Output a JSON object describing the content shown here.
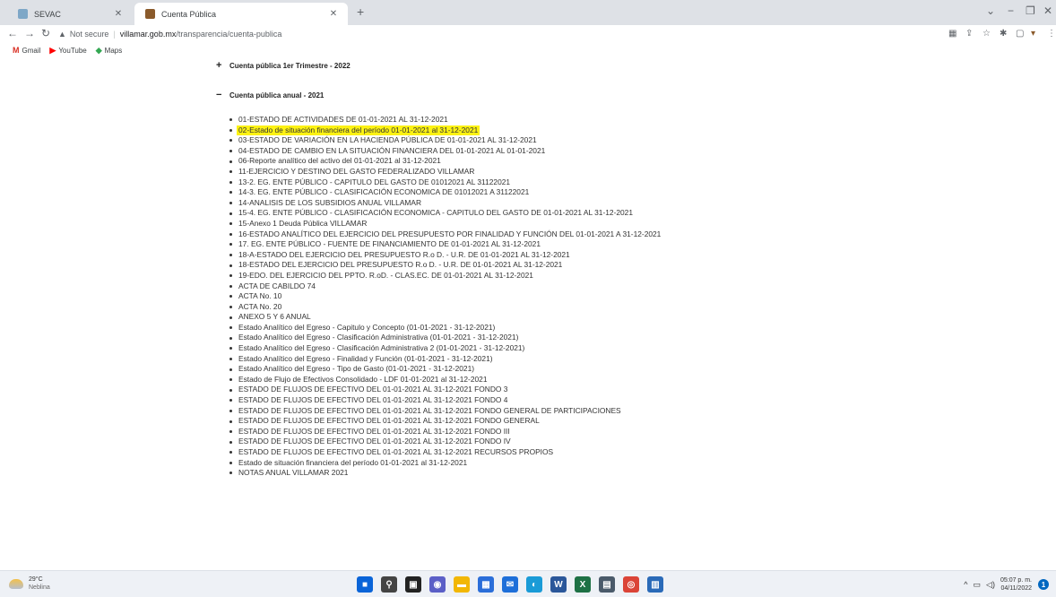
{
  "tabs": [
    {
      "title": "SEVAC",
      "favicon_color": "#7ea7c7"
    },
    {
      "title": "Cuenta Pública",
      "favicon_color": "#8a5a2b"
    }
  ],
  "toolbar": {
    "not_secure": "Not secure",
    "host": "villamar.gob.mx",
    "path": "/transparencia/cuenta-publica"
  },
  "bookmarks": [
    {
      "label": "Gmail",
      "icon": "gmail-icon",
      "color": "#d93025",
      "glyph": "M"
    },
    {
      "label": "YouTube",
      "icon": "youtube-icon",
      "color": "#ff0000",
      "glyph": "▶"
    },
    {
      "label": "Maps",
      "icon": "maps-icon",
      "color": "#34a853",
      "glyph": "◆"
    }
  ],
  "content": {
    "sections": [
      {
        "mark": "+",
        "label": "Cuenta pública 1er Trimestre - 2022"
      },
      {
        "mark": "−",
        "label": "Cuenta pública anual - 2021"
      }
    ],
    "highlight_color": "#fdf213",
    "items": [
      "01-ESTADO DE ACTIVIDADES DE 01-01-2021 AL 31-12-2021",
      "02-Estado de situación financiera del período 01-01-2021 al 31-12-2021",
      "03-ESTADO DE VARIACIÓN EN LA HACIENDA PÚBLICA DE 01-01-2021 AL 31-12-2021",
      "04-ESTADO DE CAMBIO EN LA SITUACIÓN FINANCIERA DEL 01-01-2021 AL 01-01-2021",
      "06-Reporte analítico del activo del 01-01-2021 al 31-12-2021",
      "11-EJERCICIO Y DESTINO DEL GASTO FEDERALIZADO VILLAMAR",
      "13-2. EG. ENTE PÚBLICO - CAPITULO DEL GASTO DE 01012021 AL 31122021",
      "14-3. EG. ENTE PÚBLICO - CLASIFICACIÓN ECONOMICA DE 01012021 A 31122021",
      "14-ANALISIS DE LOS SUBSIDIOS ANUAL VILLAMAR",
      "15-4. EG. ENTE PÚBLICO - CLASIFICACIÓN ECONOMICA - CAPITULO DEL GASTO DE 01-01-2021 AL 31-12-2021",
      "15-Anexo 1 Deuda Pública VILLAMAR",
      "16-ESTADO ANALÍTICO DEL EJERCICIO DEL PRESUPUESTO POR FINALIDAD Y FUNCIÓN DEL 01-01-2021 A 31-12-2021",
      "17. EG. ENTE PÚBLICO - FUENTE DE FINANCIAMIENTO DE 01-01-2021 AL 31-12-2021",
      "18-A-ESTADO DEL EJERCICIO DEL PRESUPUESTO R.o D. - U.R. DE 01-01-2021 AL 31-12-2021",
      "18-ESTADO DEL EJERCICIO DEL PRESUPUESTO R.o D. - U.R. DE 01-01-2021 AL 31-12-2021",
      "19-EDO. DEL EJERCICIO DEL PPTO. R.oD. - CLAS.EC. DE 01-01-2021 AL 31-12-2021",
      "ACTA DE CABILDO 74",
      "ACTA No. 10",
      "ACTA No. 20",
      "ANEXO 5 Y 6 ANUAL",
      "Estado Analítico del Egreso - Capitulo y Concepto (01-01-2021 - 31-12-2021)",
      "Estado Analítico del Egreso - Clasificación Administrativa (01-01-2021 - 31-12-2021)",
      "Estado Analítico del Egreso - Clasificación Administrativa 2 (01-01-2021 - 31-12-2021)",
      "Estado Analítico del Egreso - Finalidad y Función (01-01-2021 - 31-12-2021)",
      "Estado Analítico del Egreso - Tipo de Gasto (01-01-2021 - 31-12-2021)",
      "Estado de Flujo de Efectivos Consolidado - LDF 01-01-2021 al 31-12-2021",
      "ESTADO DE FLUJOS DE EFECTIVO DEL 01-01-2021 AL 31-12-2021 FONDO 3",
      "ESTADO DE FLUJOS DE EFECTIVO DEL 01-01-2021 AL 31-12-2021 FONDO 4",
      "ESTADO DE FLUJOS DE EFECTIVO DEL 01-01-2021 AL 31-12-2021 FONDO GENERAL DE PARTICIPACIONES",
      "ESTADO DE FLUJOS DE EFECTIVO DEL 01-01-2021 AL 31-12-2021 FONDO GENERAL",
      "ESTADO DE FLUJOS DE EFECTIVO DEL 01-01-2021 AL 31-12-2021 FONDO III",
      "ESTADO DE FLUJOS DE EFECTIVO DEL 01-01-2021 AL 31-12-2021 FONDO IV",
      "ESTADO DE FLUJOS DE EFECTIVO DEL 01-01-2021 AL 31-12-2021 RECURSOS PROPIOS",
      "Estado de situación financiera del período 01-01-2021 al 31-12-2021",
      "NOTAS ANUAL VILLAMAR 2021"
    ]
  },
  "taskbar": {
    "temperature": "29°C",
    "condition": "Neblina",
    "time": "05:07 p. m.",
    "date": "04/11/2022",
    "notification_count": "1",
    "apps": [
      {
        "name": "start-icon",
        "color": "#0a64d8",
        "glyph": "■"
      },
      {
        "name": "search-icon",
        "color": "#444",
        "glyph": "⚲"
      },
      {
        "name": "task-view-icon",
        "color": "#222",
        "glyph": "▣"
      },
      {
        "name": "chat-icon",
        "color": "#5b5fc7",
        "glyph": "◉"
      },
      {
        "name": "file-explorer-icon",
        "color": "#f2b705",
        "glyph": "▬"
      },
      {
        "name": "store-icon",
        "color": "#2b6ed9",
        "glyph": "▦"
      },
      {
        "name": "mail-icon",
        "color": "#1e6fd9",
        "glyph": "✉"
      },
      {
        "name": "edge-icon",
        "color": "#1a9bd7",
        "glyph": "◐"
      },
      {
        "name": "word-icon",
        "color": "#2b579a",
        "glyph": "W"
      },
      {
        "name": "excel-icon",
        "color": "#1e7145",
        "glyph": "X"
      },
      {
        "name": "calculator-icon",
        "color": "#4a5a6a",
        "glyph": "▤"
      },
      {
        "name": "chrome-icon",
        "color": "#db4437",
        "glyph": "◎"
      },
      {
        "name": "app-icon",
        "color": "#2a6ab8",
        "glyph": "▥"
      }
    ]
  }
}
